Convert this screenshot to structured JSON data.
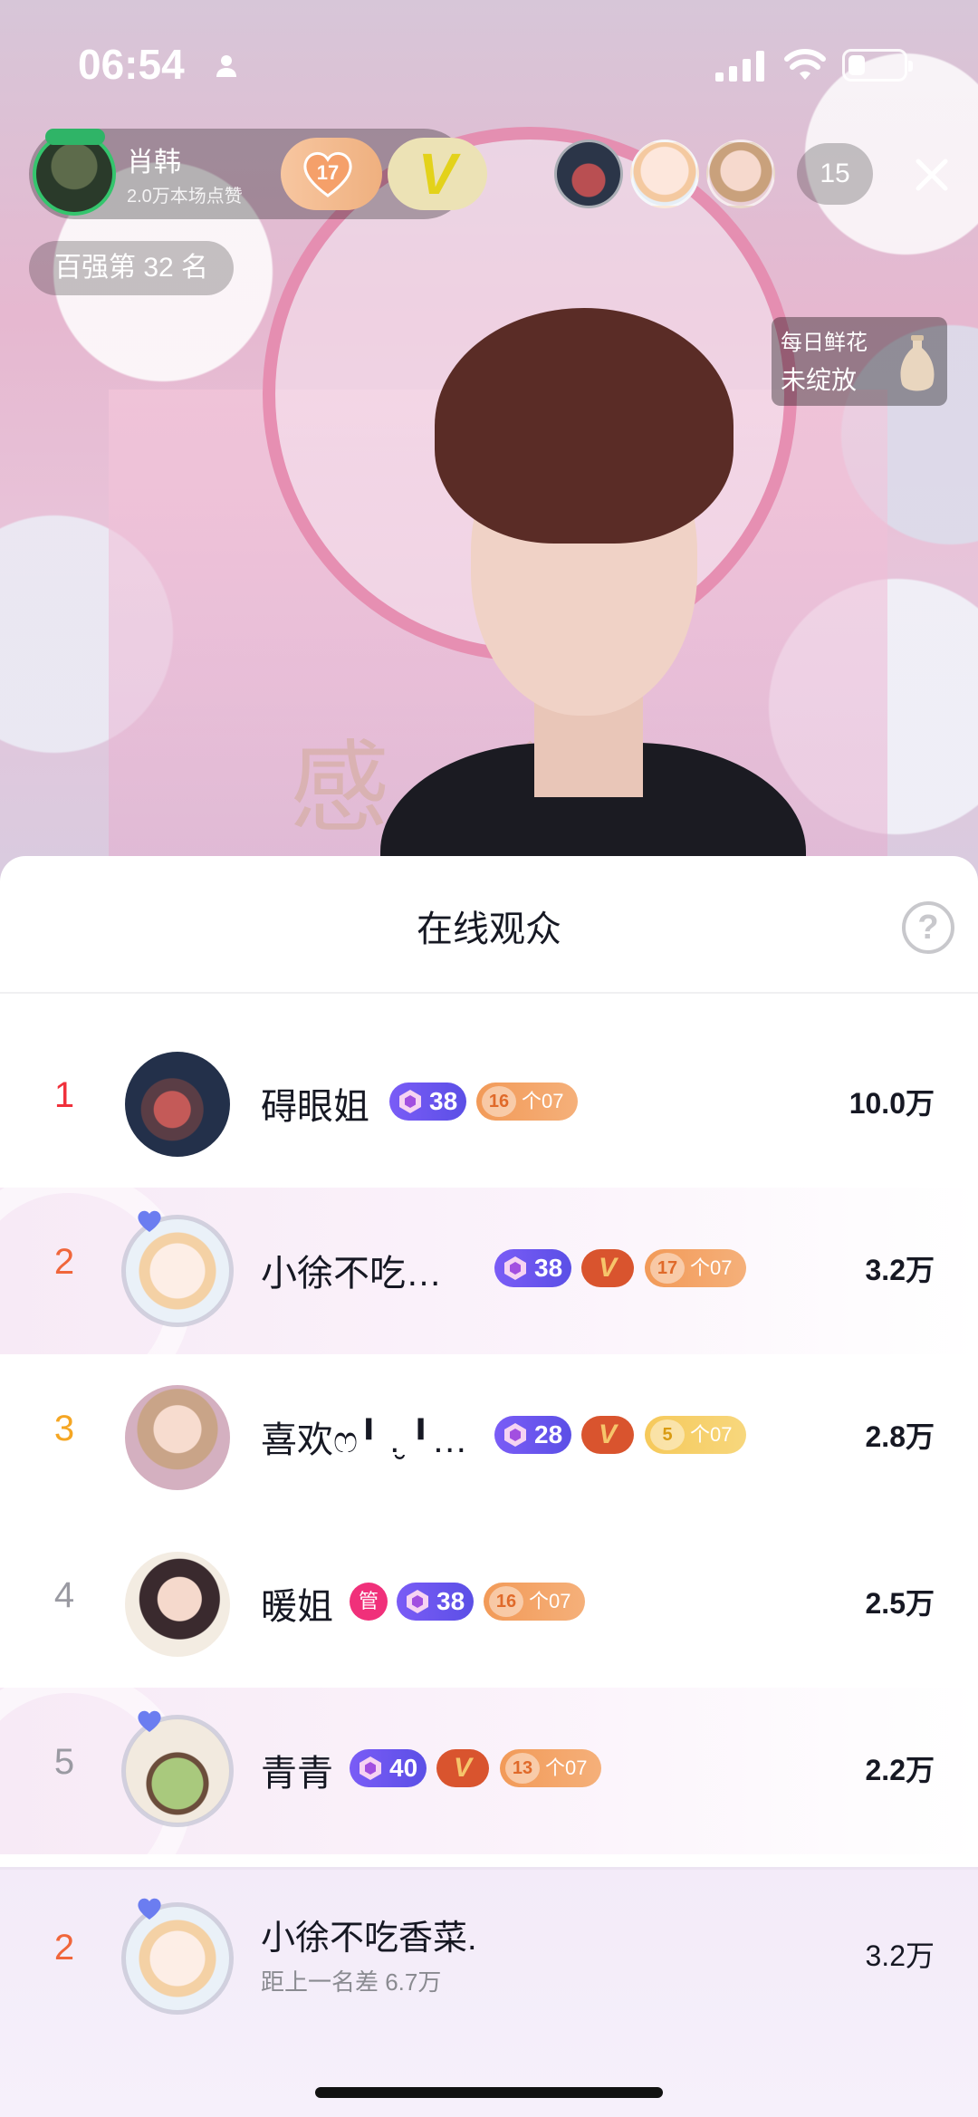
{
  "status_bar": {
    "time": "06:54",
    "battery_level": 0.3
  },
  "host": {
    "name": "肖韩",
    "likes": "2.0万本场点赞",
    "fan_level": "17"
  },
  "viewer_count": "15",
  "rank_chip": "百强第 32 名",
  "daily_flower": {
    "line1": "每日鲜花",
    "line2": "未绽放"
  },
  "sheet": {
    "title": "在线观众",
    "rows": [
      {
        "rank": "1",
        "rank_color": "#f0303b",
        "name": "碍眼姐",
        "level": "38",
        "fan_level": "16",
        "fan_text": "个07",
        "score": "10.0万",
        "avatar": "night-scene-avatar"
      },
      {
        "rank": "2",
        "rank_color": "#f0663b",
        "name": "小徐不吃…",
        "level": "38",
        "vip": "V",
        "fan_level": "17",
        "fan_text": "个07",
        "score": "3.2万",
        "avatar": "cartoon-girl-avatar"
      },
      {
        "rank": "3",
        "rank_color": "#f5a623",
        "name": "喜欢ෆ╹ .̮ ╹…",
        "level": "28",
        "vip": "V",
        "fan_level": "5",
        "fan_text": "个07",
        "score": "2.8万",
        "avatar": "doll-avatar"
      },
      {
        "rank": "4",
        "rank_color": "#9a9aa2",
        "name": "暖姐",
        "manager": "管",
        "level": "38",
        "fan_level": "16",
        "fan_text": "个07",
        "score": "2.5万",
        "avatar": "woman-avatar"
      },
      {
        "rank": "5",
        "rank_color": "#9a9aa2",
        "name": "青青",
        "level": "40",
        "vip": "V",
        "fan_level": "13",
        "fan_text": "个07",
        "score": "2.2万",
        "avatar": "frog-avatar"
      }
    ],
    "self": {
      "rank": "2",
      "name": "小徐不吃香菜.",
      "gap": "距上一名差 6.7万",
      "score": "3.2万"
    }
  }
}
